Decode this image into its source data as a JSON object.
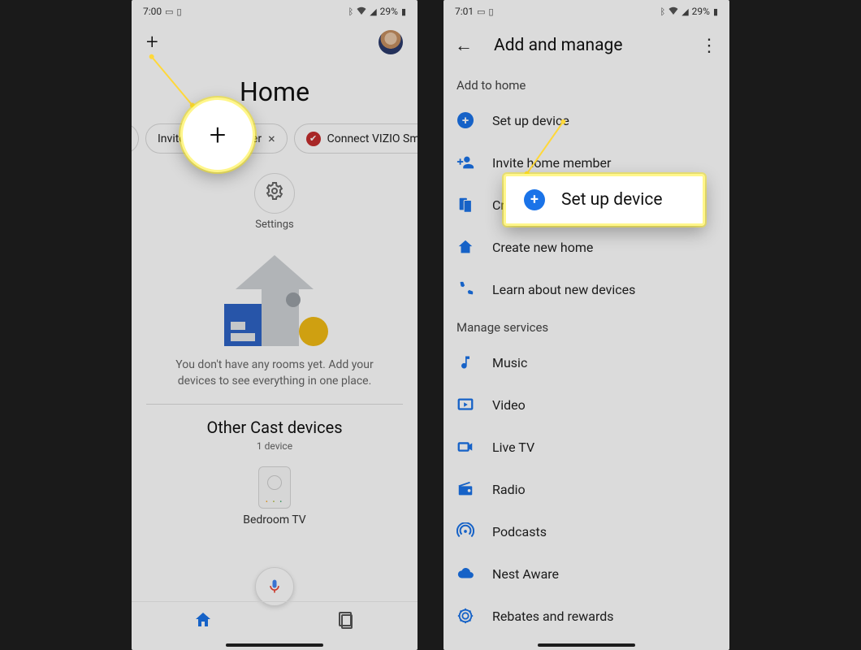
{
  "screen1": {
    "status": {
      "time": "7:00",
      "battery": "29%"
    },
    "title": "Home",
    "chips": {
      "invite": "Invite home member",
      "vizio": "Connect VIZIO Smart TV"
    },
    "settings_label": "Settings",
    "empty_text": "You don't have any rooms yet. Add your devices to see everything in one place.",
    "other_cast_title": "Other Cast devices",
    "other_cast_count": "1 device",
    "device_name": "Bedroom TV",
    "callout_symbol": "+"
  },
  "screen2": {
    "status": {
      "time": "7:01",
      "battery": "29%"
    },
    "appbar_title": "Add and manage",
    "section_add": "Add to home",
    "items_add": {
      "setup_device": "Set up device",
      "invite_member": "Invite home member",
      "create_group": "Create speaker group",
      "create_home": "Create new home",
      "learn_devices": "Learn about new devices"
    },
    "section_manage": "Manage services",
    "items_manage": {
      "music": "Music",
      "video": "Video",
      "live_tv": "Live TV",
      "radio": "Radio",
      "podcasts": "Podcasts",
      "nest_aware": "Nest Aware",
      "rebates": "Rebates and rewards"
    },
    "callout_label": "Set up device"
  }
}
